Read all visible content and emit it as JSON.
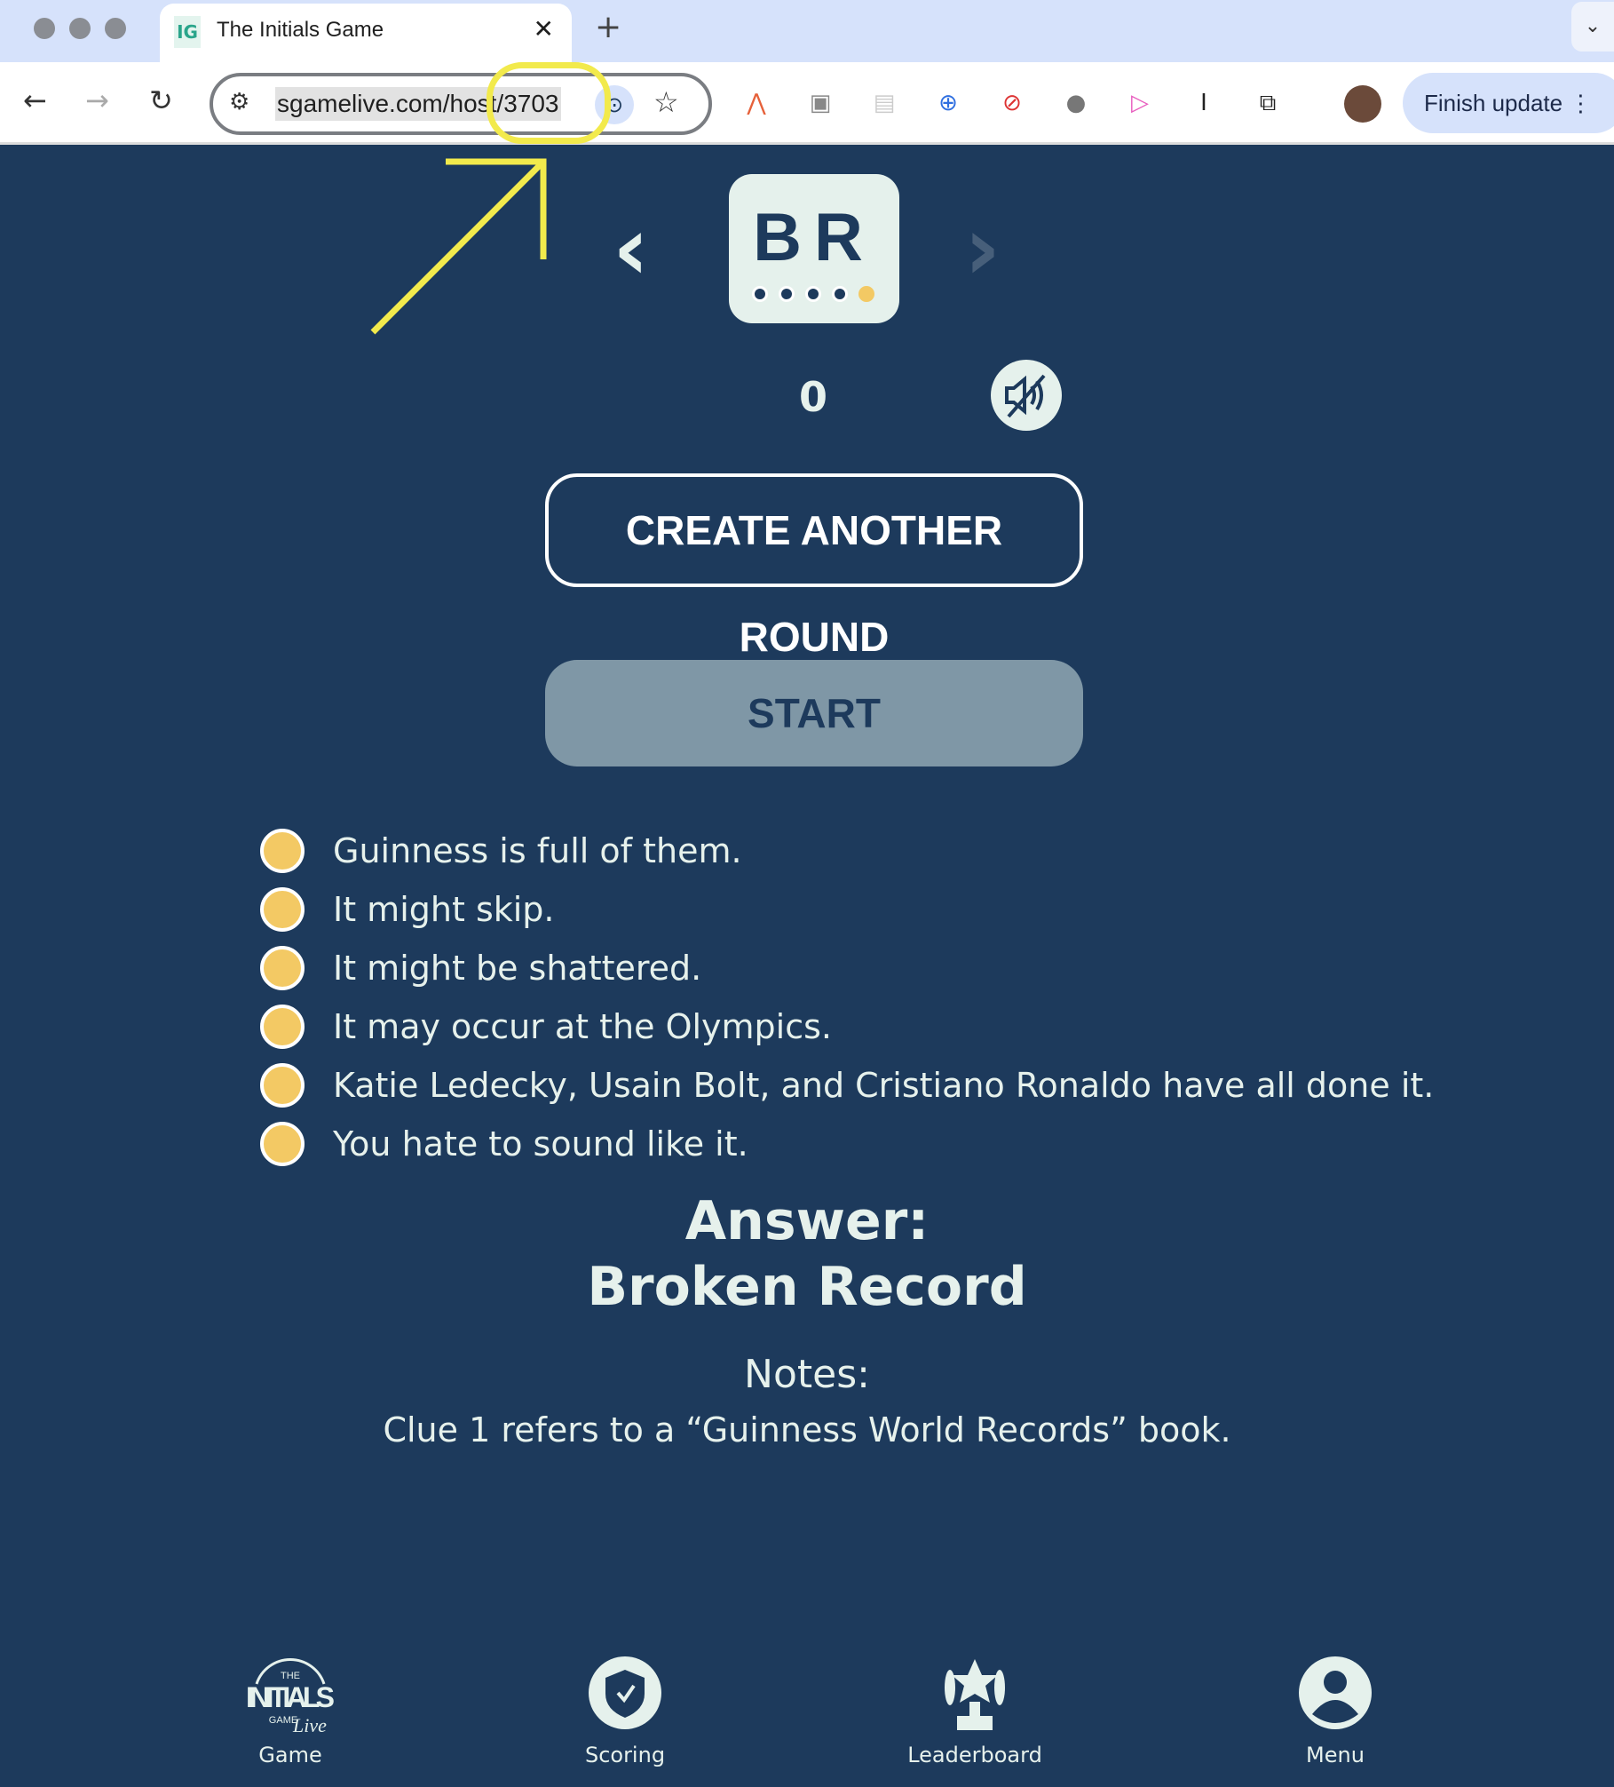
{
  "browser": {
    "tab_title": "The Initials Game",
    "favicon_text": "IG",
    "url": "sgamelive.com/host/3703",
    "finish_update": "Finish update"
  },
  "card": {
    "letters": "BR",
    "clue_count": 5,
    "active_clue": 5
  },
  "score": "0",
  "buttons": {
    "create": "CREATE ANOTHER ROUND",
    "start": "START"
  },
  "clues": [
    "Guinness is full of them.",
    "It might skip.",
    "It might be shattered.",
    "It may occur at the Olympics.",
    "Katie Ledecky, Usain Bolt, and Cristiano Ronaldo have all done it.",
    "You hate to sound like it."
  ],
  "answer": {
    "label": "Answer:",
    "value": "Broken Record"
  },
  "notes": {
    "label": "Notes:",
    "text": "Clue 1 refers to a “Guinness World Records” book."
  },
  "bottom_nav": [
    {
      "label": "Game",
      "logo_text": "THE INITIALS GAME Live"
    },
    {
      "label": "Scoring"
    },
    {
      "label": "Leaderboard"
    },
    {
      "label": "Menu"
    }
  ],
  "colors": {
    "background": "#1d3a5c",
    "accent": "#f3c964",
    "card": "#e5f1ec",
    "start_disabled": "#7f97a6",
    "annotation": "#f2ea4c"
  }
}
